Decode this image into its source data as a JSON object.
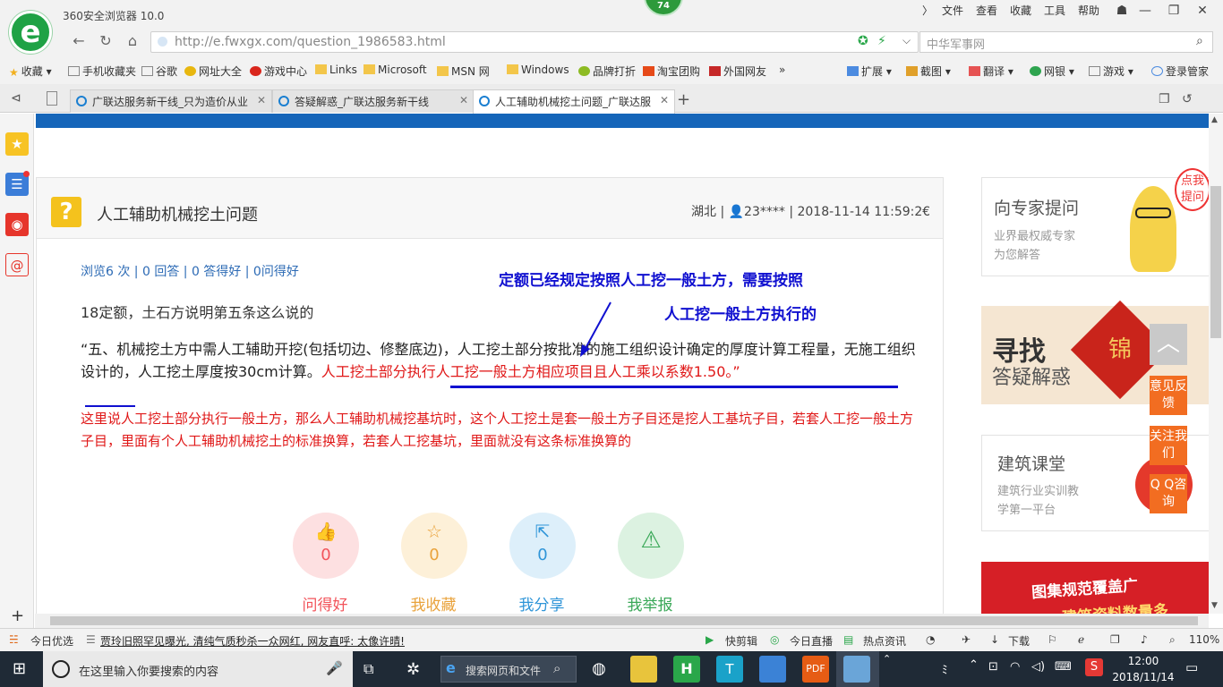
{
  "browser": {
    "title": "360安全浏览器 10.0",
    "badge": "74",
    "menus": [
      "文件",
      "查看",
      "收藏",
      "工具",
      "帮助"
    ],
    "url": "http://e.fwxgx.com/question_1986583.html",
    "search_placeholder": "中华军事网",
    "bookmarks": [
      "收藏",
      "手机收藏夹",
      "谷歌",
      "网址大全",
      "游戏中心",
      "Links",
      "Microsoft",
      "MSN 网",
      "Windows",
      "品牌打折",
      "淘宝团购",
      "外国网友"
    ],
    "bookmarks_right": [
      "扩展",
      "截图",
      "翻译",
      "网银",
      "游戏",
      "登录管家"
    ],
    "tabs": [
      {
        "label": "广联达服务新干线_只为造价从业",
        "active": false
      },
      {
        "label": "答疑解惑_广联达服务新干线",
        "active": false
      },
      {
        "label": "人工辅助机械挖土问题_广联达服",
        "active": true
      }
    ]
  },
  "question": {
    "title": "人工辅助机械挖土问题",
    "meta": "湖北 | 👤23**** | 2018-11-14 11:59:2€",
    "stats": "浏览6 次 | 0 回答 | 0 答得好 | 0问得好",
    "line1": "18定额，土石方说明第五条这么说的",
    "quote_black": "“五、机械挖土方中需人工辅助开挖(包括切边、修整底边)，人工挖土部分按批准的施工组织设计确定的厚度计算工程量，无施工组织设计的，人工挖土厚度按30cm计算。",
    "quote_red": "人工挖土部分执行人工挖一般土方相应项目且人工乘以系数1.50。”",
    "para2": "这里说人工挖土部分执行一般土方，那么人工辅助机械挖基坑时，这个人工挖土是套一般土方子目还是挖人工基坑子目，若套人工挖一般土方子目，里面有个人工辅助机械挖土的标准换算，若套人工挖基坑，里面就没有这条标准换算的",
    "annotation_line1": "定额已经规定按照人工挖一般土方，需要按照",
    "annotation_line2": "人工挖一般土方执行的",
    "actions": [
      {
        "label": "问得好",
        "count": "0",
        "icon": "👍",
        "color": "#f2545b",
        "bg": "#fde0e1"
      },
      {
        "label": "我收藏",
        "count": "0",
        "icon": "☆",
        "color": "#e9a23b",
        "bg": "#fdf0d8"
      },
      {
        "label": "我分享",
        "count": "0",
        "icon": "⇱",
        "color": "#2f95d8",
        "bg": "#ddeffa"
      },
      {
        "label": "我举报",
        "count": "",
        "icon": "⚠",
        "color": "#3aa858",
        "bg": "#dcf2e1"
      }
    ]
  },
  "right": {
    "expert_title": "向专家提问",
    "expert_sub1": "业界最权威专家",
    "expert_sub2": "为您解答",
    "bubble": "点我提问",
    "search_banner1": "寻找",
    "search_banner2": "答疑解惑",
    "search_banner3": "锦",
    "class_title": "建筑课堂",
    "class_sub1": "建筑行业实训教",
    "class_sub2": "学第一平台",
    "red_banner": "图集规范覆盖广",
    "red_banner2": "建筑资料数量多",
    "float_feedback": "意见反馈",
    "float_follow": "关注我们",
    "float_qq": "Q Q咨询"
  },
  "statusbar": {
    "left1": "今日优选",
    "news": "贾玲旧照罕见曝光, 清纯气质秒杀一众网红, 网友直呼: 太像许晴!",
    "items": [
      "快剪辑",
      "今日直播",
      "热点资讯"
    ],
    "download": "下载",
    "zoom": "110%"
  },
  "taskbar": {
    "search_placeholder": "在这里输入你要搜索的内容",
    "ie_search": "搜索网页和文件",
    "time": "12:00",
    "date": "2018/11/14"
  }
}
